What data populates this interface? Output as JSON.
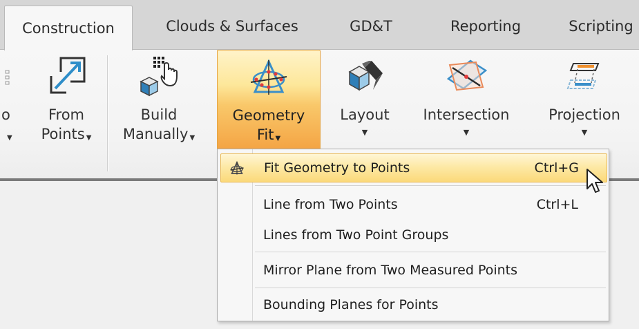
{
  "tabs": [
    {
      "label": "Construction"
    },
    {
      "label": "Clouds & Surfaces"
    },
    {
      "label": "GD&T"
    },
    {
      "label": "Reporting"
    },
    {
      "label": "Scripting"
    }
  ],
  "ribbon": {
    "partial_left_label": "o",
    "from_points": {
      "line1": "From",
      "line2": "Points"
    },
    "build_manually": {
      "line1": "Build",
      "line2": "Manually"
    },
    "geometry_fit": {
      "line1": "Geometry",
      "line2": "Fit"
    },
    "layout": {
      "line1": "Layout"
    },
    "intersection": {
      "line1": "Intersection"
    },
    "projection": {
      "line1": "Projection"
    }
  },
  "menu": {
    "items": [
      {
        "label": "Fit Geometry to Points",
        "shortcut": "Ctrl+G"
      },
      {
        "label": "Line from Two Points",
        "shortcut": "Ctrl+L"
      },
      {
        "label": "Lines from Two Point Groups",
        "shortcut": ""
      },
      {
        "label": "Mirror Plane from Two Measured Points",
        "shortcut": ""
      },
      {
        "label": "Bounding Planes for Points",
        "shortcut": ""
      }
    ]
  },
  "colors": {
    "highlight": "#fde9a6",
    "active_button": "#f9c86a",
    "accent_orange": "#f4a444"
  }
}
